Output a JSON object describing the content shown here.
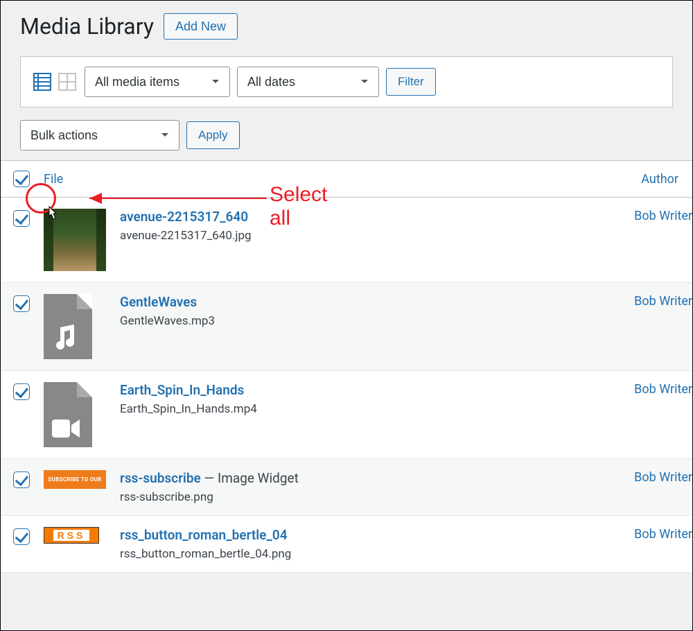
{
  "header": {
    "title": "Media Library",
    "add_new": "Add New"
  },
  "filters": {
    "media_types": "All media items",
    "dates": "All dates",
    "filter_btn": "Filter"
  },
  "bulk": {
    "label": "Bulk actions",
    "apply": "Apply"
  },
  "columns": {
    "file": "File",
    "author": "Author"
  },
  "rows": [
    {
      "title": "avenue-2215317_640",
      "filename": "avenue-2215317_640.jpg",
      "author": "Bob Writer",
      "suffix": "",
      "checked": true,
      "thumb_type": "image"
    },
    {
      "title": "GentleWaves",
      "filename": "GentleWaves.mp3",
      "author": "Bob Writer",
      "suffix": "",
      "checked": true,
      "thumb_type": "audio"
    },
    {
      "title": "Earth_Spin_In_Hands",
      "filename": "Earth_Spin_In_Hands.mp4",
      "author": "Bob Writer",
      "suffix": "",
      "checked": true,
      "thumb_type": "video"
    },
    {
      "title": "rss-subscribe",
      "filename": "rss-subscribe.png",
      "author": "Bob Writer",
      "suffix": " — Image Widget",
      "checked": true,
      "thumb_type": "subscribe"
    },
    {
      "title": "rss_button_roman_bertle_04",
      "filename": "rss_button_roman_bertle_04.png",
      "author": "Bob Writer",
      "suffix": "",
      "checked": true,
      "thumb_type": "rss"
    }
  ],
  "annotation": {
    "label": "Select all"
  },
  "select_all_checked": true
}
